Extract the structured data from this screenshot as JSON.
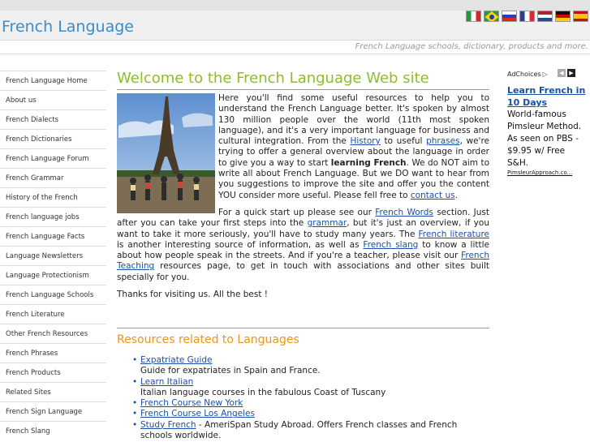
{
  "header": {
    "site_title": "French Language",
    "tagline": "French Language schools, dictionary, products and more."
  },
  "flags": [
    {
      "name": "italy-flag",
      "colors": [
        "#1e9a3c",
        "#ffffff",
        "#d8262c"
      ],
      "layout": "vertical"
    },
    {
      "name": "brazil-flag",
      "colors": [
        "#2a9a3a",
        "#f6d41a",
        "#213e9a"
      ],
      "layout": "brazil"
    },
    {
      "name": "russia-flag",
      "colors": [
        "#ffffff",
        "#2d3fb0",
        "#d52b1e"
      ],
      "layout": "horizontal"
    },
    {
      "name": "france-flag",
      "colors": [
        "#2a3f9d",
        "#ffffff",
        "#e3262e"
      ],
      "layout": "vertical"
    },
    {
      "name": "netherlands-flag",
      "colors": [
        "#b4232b",
        "#ffffff",
        "#2a4699"
      ],
      "layout": "horizontal"
    },
    {
      "name": "germany-flag",
      "colors": [
        "#111111",
        "#dd0000",
        "#ffce00"
      ],
      "layout": "horizontal"
    },
    {
      "name": "spain-flag",
      "colors": [
        "#c60b1e",
        "#ffc400",
        "#c60b1e"
      ],
      "layout": "spain"
    }
  ],
  "sidebar": {
    "items": [
      "French Language Home",
      "About us",
      "French Dialects",
      "French Dictionaries",
      "French Language Forum",
      "French Grammar",
      "History of the French",
      "French language jobs",
      "French Language Facts",
      "Language Newsletters",
      "Language Protectionism",
      "French Language Schools",
      "French Literature",
      "Other French Resources",
      "French Phrases",
      "French Products",
      "Related Sites",
      "French Sign Language",
      "French Slang"
    ]
  },
  "main": {
    "heading": "Welcome to the French Language Web site",
    "p1": {
      "t1": "Here you'll find some useful resources to help you to understand the French Language better. It's spoken by almost 130 million people over the world (11th most spoken language), and it's a very important language for business and cultural integration. From the ",
      "link_history": "History",
      "t2": " to useful ",
      "link_phrases": "phrases",
      "t3": ", we're trying to offer a general overview about the language in order to give you a way to start ",
      "bold": "learning French",
      "t4": ". We do NOT aim to write all about French Language. But we DO want to hear from you suggestions to improve the site and offer you the content YOU consider more useful. Please fell free to ",
      "link_contact": "contact us",
      "t5": "."
    },
    "p2": {
      "t1": "For a quick start up please see our ",
      "link_words": "French Words",
      "t2": " section. Just after you can take your first steps into the ",
      "link_grammar": "grammar",
      "t3": ", but it's just an overview, if you want to take it more seriously, you'll have to study many years.  The ",
      "link_literature": "French literature",
      "t4": " is another interesting source of information, as well as ",
      "link_slang": "French slang",
      "t5": " to know a little about how people speak in the streets. And if you're a teacher, please visit our ",
      "link_teaching": "French Teaching",
      "t6": " resources page, to get in touch with associations and other sites built specially for you."
    },
    "p3": "Thanks for visiting us. All the best !"
  },
  "resources": {
    "title": "Resources related to Languages",
    "items": [
      {
        "link": "Expatriate Guide",
        "desc": "Guide for expatriates in Spain and France."
      },
      {
        "link": "Learn Italian",
        "desc": "Italian language courses in the fabulous Coast of Tuscany"
      },
      {
        "link": "French Course New York",
        "desc": ""
      },
      {
        "link": "French Course Los Angeles",
        "desc": ""
      },
      {
        "link": "Study French",
        "inline": " - AmeriSpan Study Abroad. Offers French classes and French schools worldwide."
      }
    ]
  },
  "ad": {
    "adchoices": "AdChoices",
    "title": "Learn French in 10 Days",
    "body": "World-famous Pimsleur Method. As seen on PBS - $9.95 w/ Free S&H.",
    "url": "PimsleurApproach.co..."
  },
  "colors": {
    "title_blue": "#3a8ccc",
    "heading_green": "#8fbd2a",
    "resources_orange": "#e8961e",
    "link_blue": "#1a4fa8"
  }
}
